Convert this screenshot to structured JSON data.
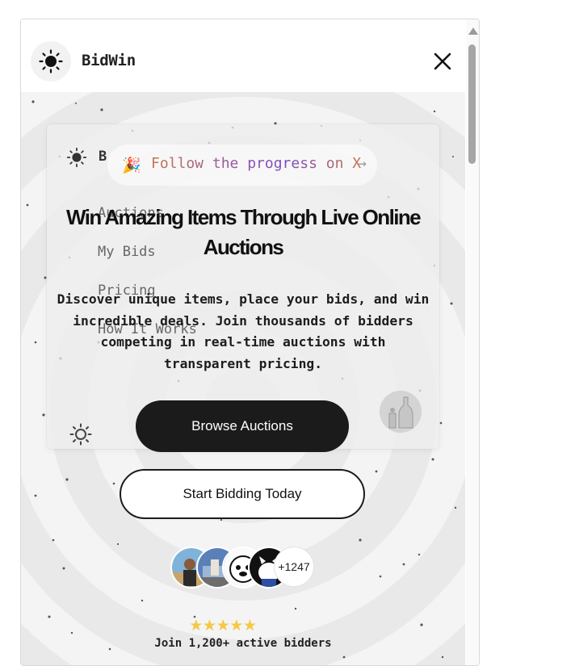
{
  "app": {
    "brand": "BidWin"
  },
  "ghost_menu": {
    "brand_initial": "B",
    "links": [
      "Auctions",
      "My Bids",
      "Pricing",
      "How It Works"
    ]
  },
  "announcement": {
    "emoji": "🎉",
    "text": "Follow the progress on X",
    "arrow": "→"
  },
  "hero": {
    "headline": "Win Amazing Items Through Live Online Auctions",
    "subtext": "Discover unique items, place your bids, and win incredible deals. Join thousands of bidders competing in real-time auctions with transparent pricing.",
    "primary_cta": "Browse Auctions",
    "secondary_cta": "Start Bidding Today"
  },
  "social_proof": {
    "extra_count": "+1247",
    "rating_stars": 5,
    "caption": "Join 1,200+ active bidders"
  },
  "colors": {
    "primary_button": "#1b1b1b",
    "star": "#f5c945",
    "gradient_start": "#c9744b",
    "gradient_mid": "#8d52b5"
  },
  "icons": [
    "sun-icon",
    "close-icon",
    "party-popper-icon",
    "arrow-right-icon",
    "star-icon"
  ]
}
